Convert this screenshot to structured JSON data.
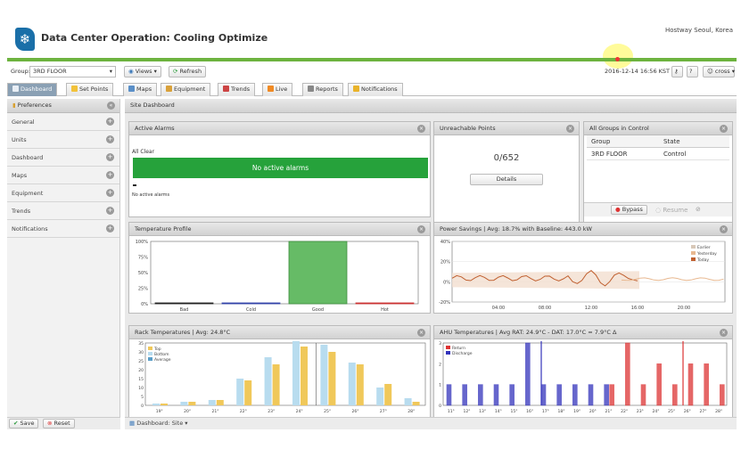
{
  "app": {
    "title": "Data Center Operation: Cooling Optimize",
    "site": "Hostway Seoul, Korea",
    "logo_icon": "snowflake-icon"
  },
  "toolbar": {
    "group_label": "Group:",
    "group_value": "3RD FLOOR",
    "views": "Views",
    "refresh": "Refresh",
    "datetime": "2016-12-14 16:56 KST",
    "user": "cross"
  },
  "tabs": [
    {
      "label": "Dashboard",
      "icon": "dashboard-icon"
    },
    {
      "label": "Set Points",
      "icon": "setpoints-icon"
    },
    {
      "label": "Maps",
      "icon": "map-icon"
    },
    {
      "label": "Equipment",
      "icon": "equipment-icon"
    },
    {
      "label": "Trends",
      "icon": "trend-icon"
    },
    {
      "label": "Live",
      "icon": "rss-icon"
    },
    {
      "label": "Reports",
      "icon": "report-icon"
    },
    {
      "label": "Notifications",
      "icon": "warning-icon"
    }
  ],
  "sidebar": {
    "title": "Preferences",
    "items": [
      "General",
      "Units",
      "Dashboard",
      "Maps",
      "Equipment",
      "Trends",
      "Notifications"
    ],
    "save": "Save",
    "reset": "Reset"
  },
  "main": {
    "title": "Site Dashboard",
    "footer": "Dashboard: Site"
  },
  "active_alarms": {
    "title": "Active Alarms",
    "status": "All Clear",
    "bar": "No active alarms",
    "note": "No active alarms"
  },
  "unreachable": {
    "title": "Unreachable Points",
    "value": "0/652",
    "details": "Details"
  },
  "groups": {
    "title": "All Groups in Control",
    "col_group": "Group",
    "col_state": "State",
    "row_group": "3RD FLOOR",
    "row_state": "Control",
    "bypass": "Bypass",
    "resume": "Resume"
  },
  "temp_profile": {
    "title": "Temperature Profile"
  },
  "power": {
    "title": "Power Savings | Avg: 18.7% with Baseline: 443.0 kW"
  },
  "rack": {
    "title": "Rack Temperatures | Avg: 24.8°C"
  },
  "ahu": {
    "title": "AHU Temperatures | Avg RAT: 24.9°C - DAT: 17.0°C = 7.9°C Δ"
  },
  "chart_data": [
    {
      "type": "bar",
      "categories": [
        "Bad",
        "Cold",
        "Good",
        "Hot"
      ],
      "values": [
        0,
        0,
        100,
        0
      ],
      "yticks": [
        "100%",
        "75%",
        "50%",
        "25%",
        "0%"
      ],
      "ylim": [
        0,
        100
      ],
      "colors": [
        "#222222",
        "#3344aa",
        "#66bb66",
        "#cc3333"
      ]
    },
    {
      "type": "line",
      "x": [
        "04:00",
        "08:00",
        "12:00",
        "16:00",
        "20:00"
      ],
      "yticks": [
        "40%",
        "20%",
        "0%",
        "-20%"
      ],
      "ylim": [
        -20,
        40
      ],
      "series": [
        {
          "name": "Earlier",
          "color": "#d8c8b8"
        },
        {
          "name": "Yesterday",
          "color": "#e8b890"
        },
        {
          "name": "Today",
          "color": "#c06030"
        }
      ]
    },
    {
      "type": "bar",
      "categories": [
        "19°",
        "20°",
        "21°",
        "22°",
        "23°",
        "24°",
        "25°",
        "26°",
        "27°",
        "28°"
      ],
      "yticks": [
        "35",
        "30",
        "25",
        "20",
        "15",
        "10",
        "5",
        "0"
      ],
      "ylim": [
        0,
        35
      ],
      "series": [
        {
          "name": "Top",
          "color": "#f0c85a",
          "values": [
            1,
            2,
            3,
            14,
            23,
            33,
            30,
            23,
            12,
            2
          ]
        },
        {
          "name": "Bottom",
          "color": "#b8dcef",
          "values": [
            1,
            2,
            3,
            15,
            27,
            36,
            34,
            24,
            10,
            4
          ]
        },
        {
          "name": "Average",
          "color": "#5a9ec8",
          "values": [
            0,
            0,
            0,
            0,
            0,
            0,
            0,
            0,
            0,
            0
          ]
        }
      ]
    },
    {
      "type": "bar",
      "categories": [
        "11°",
        "12°",
        "13°",
        "14°",
        "15°",
        "16°",
        "17°",
        "18°",
        "19°",
        "20°",
        "21°",
        "22°",
        "23°",
        "24°",
        "25°",
        "26°",
        "27°",
        "28°"
      ],
      "yticks": [
        "3",
        "2",
        "1",
        "0"
      ],
      "ylim": [
        0,
        3
      ],
      "series": [
        {
          "name": "Return",
          "color": "#dd3333",
          "values": [
            0,
            0,
            0,
            0,
            0,
            0,
            0,
            0,
            0,
            0,
            1,
            3,
            1,
            2,
            1,
            2,
            2,
            1
          ]
        },
        {
          "name": "Discharge",
          "color": "#3333bb",
          "values": [
            1,
            1,
            1,
            1,
            1,
            3,
            1,
            1,
            1,
            1,
            1,
            0,
            0,
            0,
            0,
            0,
            0,
            0
          ]
        }
      ]
    }
  ]
}
